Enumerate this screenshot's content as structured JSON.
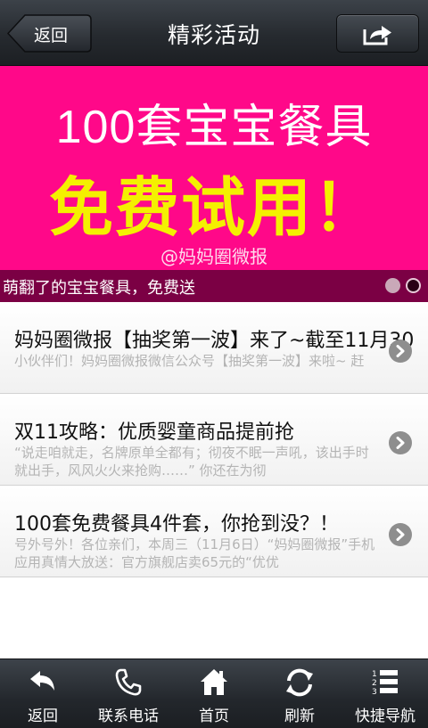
{
  "header": {
    "back_label": "返回",
    "title": "精彩活动",
    "share_icon": "share-icon"
  },
  "banner": {
    "line1": "100套宝宝餐具",
    "line2": "免费试用！",
    "watermark": "@妈妈圈微报",
    "caption": "萌翻了的宝宝餐具，免费送",
    "slide_count": 2,
    "active_slide": 2,
    "colors": {
      "background": "#ff0889",
      "headline_yellow": "#f4f000",
      "caption_bar": "#7b0044"
    }
  },
  "list": {
    "items": [
      {
        "title": "妈妈圈微报【抽奖第一波】来了~截至11月30",
        "desc": "小伙伴们！妈妈圈微报微信公众号【抽奖第一波】来啦~ 赶"
      },
      {
        "title": "双11攻略：优质婴童商品提前抢",
        "desc": "“说走咱就走，名牌原单全都有；彻夜不眠一声吼，该出手时就出手，风风火火来抢购……” 你还在为彻"
      },
      {
        "title": "100套免费餐具4件套，你抢到没？！",
        "desc": "号外号外！各位亲们，本周三（11月6日）“妈妈圈微报”手机应用真情大放送：官方旗舰店卖65元的“优优"
      }
    ],
    "arrow_icon": "chevron-right-icon"
  },
  "nav": {
    "items": [
      {
        "label": "返回",
        "icon": "back-arrow-icon"
      },
      {
        "label": "联系电话",
        "icon": "phone-icon"
      },
      {
        "label": "首页",
        "icon": "home-icon"
      },
      {
        "label": "刷新",
        "icon": "refresh-icon"
      },
      {
        "label": "快捷导航",
        "icon": "list-nav-icon"
      }
    ]
  }
}
